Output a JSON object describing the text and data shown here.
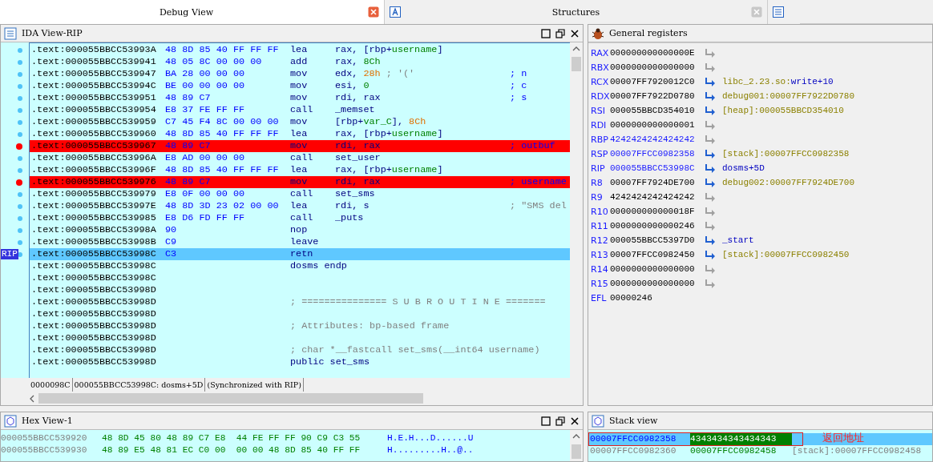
{
  "tabs": [
    {
      "label": "Debug View",
      "selected": true
    },
    {
      "label": "Structures",
      "selected": false
    }
  ],
  "ida_view": {
    "title": "IDA View-RIP",
    "rows": [
      {
        "address": ".text:000055BBCC53993A",
        "bytes": "48 8D 85 40 FF FF FF",
        "mnemonic": "lea",
        "operands": [
          {
            "text": "rax, [rbp+",
            "kind": "plain"
          },
          {
            "text": "username",
            "kind": "var"
          },
          {
            "text": "]",
            "kind": "plain"
          }
        ],
        "traced": true,
        "breakpoint": false,
        "current": false
      },
      {
        "address": ".text:000055BBCC539941",
        "bytes": "48 05 8C 00 00 00",
        "mnemonic": "add",
        "operands": [
          {
            "text": "rax, ",
            "kind": "plain"
          },
          {
            "text": "8Ch",
            "kind": "var"
          }
        ],
        "traced": true,
        "breakpoint": false,
        "current": false
      },
      {
        "address": ".text:000055BBCC539947",
        "bytes": "BA 28 00 00 00",
        "mnemonic": "mov",
        "operands": [
          {
            "text": "edx, ",
            "kind": "plain"
          },
          {
            "text": "28h",
            "kind": "num"
          },
          {
            "text": " ; '('",
            "kind": "str"
          }
        ],
        "comment": {
          "text": "; n",
          "kind": "auto"
        },
        "traced": true,
        "breakpoint": false,
        "current": false
      },
      {
        "address": ".text:000055BBCC53994C",
        "bytes": "BE 00 00 00 00",
        "mnemonic": "mov",
        "operands": [
          {
            "text": "esi, ",
            "kind": "plain"
          },
          {
            "text": "0",
            "kind": "var"
          }
        ],
        "comment": {
          "text": "; c",
          "kind": "auto"
        },
        "traced": true,
        "breakpoint": false,
        "current": false
      },
      {
        "address": ".text:000055BBCC539951",
        "bytes": "48 89 C7",
        "mnemonic": "mov",
        "operands": [
          {
            "text": "rdi, rax",
            "kind": "plain"
          }
        ],
        "comment": {
          "text": "; s",
          "kind": "auto"
        },
        "traced": true,
        "breakpoint": false,
        "current": false
      },
      {
        "address": ".text:000055BBCC539954",
        "bytes": "E8 37 FE FF FF",
        "mnemonic": "call",
        "operands": [
          {
            "text": "_memset",
            "kind": "plain"
          }
        ],
        "traced": true,
        "breakpoint": false,
        "current": false
      },
      {
        "address": ".text:000055BBCC539959",
        "bytes": "C7 45 F4 8C 00 00 00",
        "mnemonic": "mov",
        "operands": [
          {
            "text": "[rbp+",
            "kind": "plain"
          },
          {
            "text": "var_C",
            "kind": "var"
          },
          {
            "text": "], ",
            "kind": "plain"
          },
          {
            "text": "8Ch",
            "kind": "num"
          }
        ],
        "traced": true,
        "breakpoint": false,
        "current": false
      },
      {
        "address": ".text:000055BBCC539960",
        "bytes": "48 8D 85 40 FF FF FF",
        "mnemonic": "lea",
        "operands": [
          {
            "text": "rax, [rbp+",
            "kind": "plain"
          },
          {
            "text": "username",
            "kind": "var"
          },
          {
            "text": "]",
            "kind": "plain"
          }
        ],
        "traced": true,
        "breakpoint": false,
        "current": false
      },
      {
        "address": ".text:000055BBCC539967",
        "bytes": "48 89 C7",
        "mnemonic": "mov",
        "operands": [
          {
            "text": "rdi, rax",
            "kind": "plain"
          }
        ],
        "comment": {
          "text": "; outbuf",
          "kind": "auto"
        },
        "traced": true,
        "breakpoint": true,
        "current": false
      },
      {
        "address": ".text:000055BBCC53996A",
        "bytes": "E8 AD 00 00 00",
        "mnemonic": "call",
        "operands": [
          {
            "text": "set_user",
            "kind": "plain"
          }
        ],
        "traced": true,
        "breakpoint": false,
        "current": false
      },
      {
        "address": ".text:000055BBCC53996F",
        "bytes": "48 8D 85 40 FF FF FF",
        "mnemonic": "lea",
        "operands": [
          {
            "text": "rax, [rbp+",
            "kind": "plain"
          },
          {
            "text": "username",
            "kind": "var"
          },
          {
            "text": "]",
            "kind": "plain"
          }
        ],
        "traced": true,
        "breakpoint": false,
        "current": false
      },
      {
        "address": ".text:000055BBCC539976",
        "bytes": "48 89 C7",
        "mnemonic": "mov",
        "operands": [
          {
            "text": "rdi, rax",
            "kind": "plain"
          }
        ],
        "comment": {
          "text": "; username",
          "kind": "auto"
        },
        "traced": true,
        "breakpoint": true,
        "current": false
      },
      {
        "address": ".text:000055BBCC539979",
        "bytes": "E8 0F 00 00 00",
        "mnemonic": "call",
        "operands": [
          {
            "text": "set_sms",
            "kind": "plain"
          }
        ],
        "traced": true,
        "breakpoint": false,
        "current": false
      },
      {
        "address": ".text:000055BBCC53997E",
        "bytes": "48 8D 3D 23 02 00 00",
        "mnemonic": "lea",
        "operands": [
          {
            "text": "rdi, s",
            "kind": "plain"
          }
        ],
        "comment": {
          "text": "; \"SMS del",
          "kind": "string"
        },
        "traced": true,
        "breakpoint": false,
        "current": false
      },
      {
        "address": ".text:000055BBCC539985",
        "bytes": "E8 D6 FD FF FF",
        "mnemonic": "call",
        "operands": [
          {
            "text": "_puts",
            "kind": "plain"
          }
        ],
        "traced": true,
        "breakpoint": false,
        "current": false
      },
      {
        "address": ".text:000055BBCC53998A",
        "bytes": "90",
        "mnemonic": "nop",
        "traced": true,
        "breakpoint": false,
        "current": false
      },
      {
        "address": ".text:000055BBCC53998B",
        "bytes": "C9",
        "mnemonic": "leave",
        "traced": true,
        "breakpoint": false,
        "current": false
      },
      {
        "address": ".text:000055BBCC53998C",
        "bytes": "C3",
        "mnemonic": "retn",
        "traced": true,
        "breakpoint": false,
        "current": true,
        "pointer": "RIP"
      },
      {
        "address": ".text:000055BBCC53998C",
        "note": {
          "text": "dosms endp",
          "kind": "keyword"
        },
        "traced": false,
        "breakpoint": false,
        "current": false
      },
      {
        "address": ".text:000055BBCC53998C",
        "traced": false,
        "breakpoint": false,
        "current": false
      },
      {
        "address": ".text:000055BBCC53998D",
        "traced": false,
        "breakpoint": false,
        "current": false
      },
      {
        "address": ".text:000055BBCC53998D",
        "note": {
          "text": "; =============== S U B R O U T I N E =======",
          "kind": "comment"
        },
        "traced": false,
        "breakpoint": false,
        "current": false
      },
      {
        "address": ".text:000055BBCC53998D",
        "traced": false,
        "breakpoint": false,
        "current": false
      },
      {
        "address": ".text:000055BBCC53998D",
        "note": {
          "text": "; Attributes: bp-based frame",
          "kind": "comment"
        },
        "traced": false,
        "breakpoint": false,
        "current": false
      },
      {
        "address": ".text:000055BBCC53998D",
        "traced": false,
        "breakpoint": false,
        "current": false
      },
      {
        "address": ".text:000055BBCC53998D",
        "note": {
          "text": "; char *__fastcall set_sms(__int64 username)",
          "kind": "comment"
        },
        "traced": false,
        "breakpoint": false,
        "current": false
      },
      {
        "address": ".text:000055BBCC53998D",
        "note": {
          "text": "public set_sms",
          "kind": "keyword"
        },
        "traced": false,
        "breakpoint": false,
        "current": false
      }
    ],
    "status": [
      "0000098C",
      "000055BBCC53998C: dosms+5D",
      "(Synchronized with RIP)"
    ]
  },
  "registers": {
    "title": "General registers",
    "rows": [
      {
        "name": "RAX",
        "value": "000000000000000E",
        "changed": false,
        "arrow": true
      },
      {
        "name": "RBX",
        "value": "0000000000000000",
        "changed": false,
        "arrow": true
      },
      {
        "name": "RCX",
        "value": "00007FF7920012C0",
        "changed": false,
        "arrow": true,
        "target": [
          {
            "text": "libc_2.23.so:",
            "kind": "segment"
          },
          {
            "text": "write+10",
            "kind": "symbol"
          }
        ]
      },
      {
        "name": "RDX",
        "value": "00007FF7922D0780",
        "changed": false,
        "arrow": true,
        "target": [
          {
            "text": "debug001:00007FF7922D0780",
            "kind": "segment"
          }
        ]
      },
      {
        "name": "RSI",
        "value": "000055BBCD354010",
        "changed": false,
        "arrow": true,
        "target": [
          {
            "text": "[heap]:000055BBCD354010",
            "kind": "segment"
          }
        ]
      },
      {
        "name": "RDI",
        "value": "0000000000000001",
        "changed": false,
        "arrow": true
      },
      {
        "name": "RBP",
        "value": "4242424242424242",
        "changed": true,
        "arrow": true
      },
      {
        "name": "RSP",
        "value": "00007FFCC0982358",
        "changed": true,
        "arrow": true,
        "target": [
          {
            "text": "[stack]:00007FFCC0982358",
            "kind": "segment"
          }
        ]
      },
      {
        "name": "RIP",
        "value": "000055BBCC53998C",
        "changed": true,
        "arrow": true,
        "target": [
          {
            "text": "dosms+5D",
            "kind": "symbol"
          }
        ]
      },
      {
        "name": "R8",
        "value": "00007FF7924DE700",
        "changed": false,
        "arrow": true,
        "target": [
          {
            "text": "debug002:00007FF7924DE700",
            "kind": "segment"
          }
        ]
      },
      {
        "name": "R9",
        "value": "4242424242424242",
        "changed": false,
        "arrow": true
      },
      {
        "name": "R10",
        "value": "000000000000018F",
        "changed": false,
        "arrow": true
      },
      {
        "name": "R11",
        "value": "0000000000000246",
        "changed": false,
        "arrow": true
      },
      {
        "name": "R12",
        "value": "000055BBCC5397D0",
        "changed": false,
        "arrow": true,
        "target": [
          {
            "text": "_start",
            "kind": "symbol"
          }
        ]
      },
      {
        "name": "R13",
        "value": "00007FFCC0982450",
        "changed": false,
        "arrow": true,
        "target": [
          {
            "text": "[stack]:00007FFCC0982450",
            "kind": "segment"
          }
        ]
      },
      {
        "name": "R14",
        "value": "0000000000000000",
        "changed": false,
        "arrow": true
      },
      {
        "name": "R15",
        "value": "0000000000000000",
        "changed": false,
        "arrow": true
      },
      {
        "name": "EFL",
        "value": "00000246",
        "changed": false,
        "arrow": false
      }
    ]
  },
  "hex_view": {
    "title": "Hex View-1",
    "rows": [
      {
        "address": "000055BBCC539920",
        "bytes": "48 8D 45 80 48 89 C7 E8  44 FE FF FF 90 C9 C3 55",
        "ascii": "H.E.H...D......U"
      },
      {
        "address": "000055BBCC539930",
        "bytes": "48 89 E5 48 81 EC C0 00  00 00 48 8D 85 40 FF FF",
        "ascii": "H.........H..@.."
      }
    ]
  },
  "stack_view": {
    "title": "Stack view",
    "annotation": "返回地址",
    "rows": [
      {
        "address": "00007FFCC0982358",
        "value": "4343434343434343",
        "selected": true
      },
      {
        "address": "00007FFCC0982360",
        "value": "00007FFCC0982458",
        "comment": "[stack]:00007FFCC0982458",
        "selected": false
      }
    ]
  }
}
